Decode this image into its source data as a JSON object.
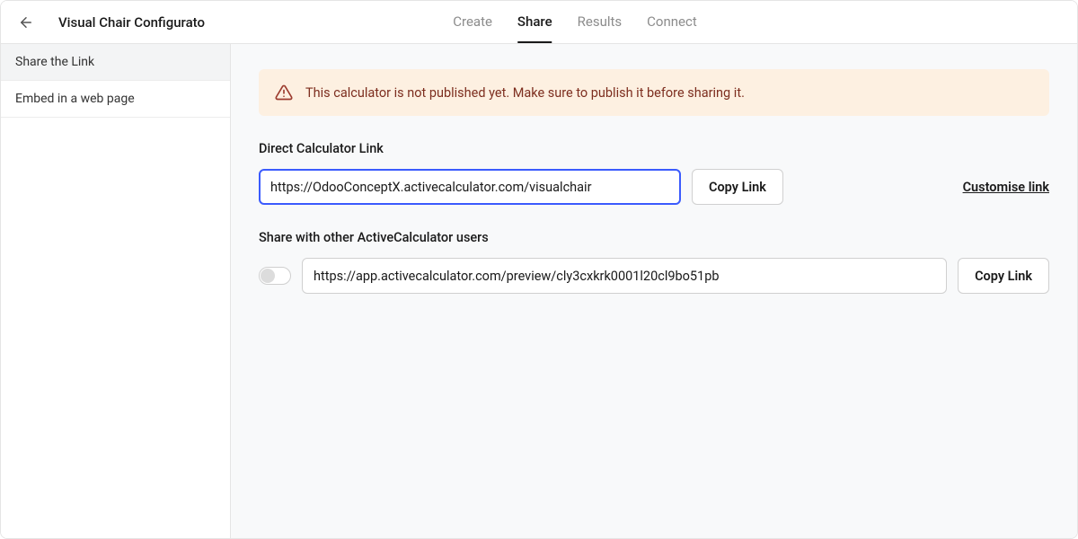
{
  "header": {
    "title": "Visual Chair Configurato",
    "tabs": [
      {
        "label": "Create",
        "active": false
      },
      {
        "label": "Share",
        "active": true
      },
      {
        "label": "Results",
        "active": false
      },
      {
        "label": "Connect",
        "active": false
      }
    ]
  },
  "sidebar": {
    "items": [
      {
        "label": "Share the Link",
        "active": true
      },
      {
        "label": "Embed in a web page",
        "active": false
      }
    ]
  },
  "alert": {
    "message": "This calculator is not published yet. Make sure to publish it before sharing it."
  },
  "direct": {
    "label": "Direct Calculator Link",
    "url": "https://OdooConceptX.activecalculator.com/visualchair",
    "copy_label": "Copy Link",
    "customise_label": "Customise link"
  },
  "share": {
    "label": "Share with other ActiveCalculator users",
    "toggle_on": false,
    "url": "https://app.activecalculator.com/preview/cly3cxkrk0001l20cl9bo51pb",
    "copy_label": "Copy Link"
  }
}
